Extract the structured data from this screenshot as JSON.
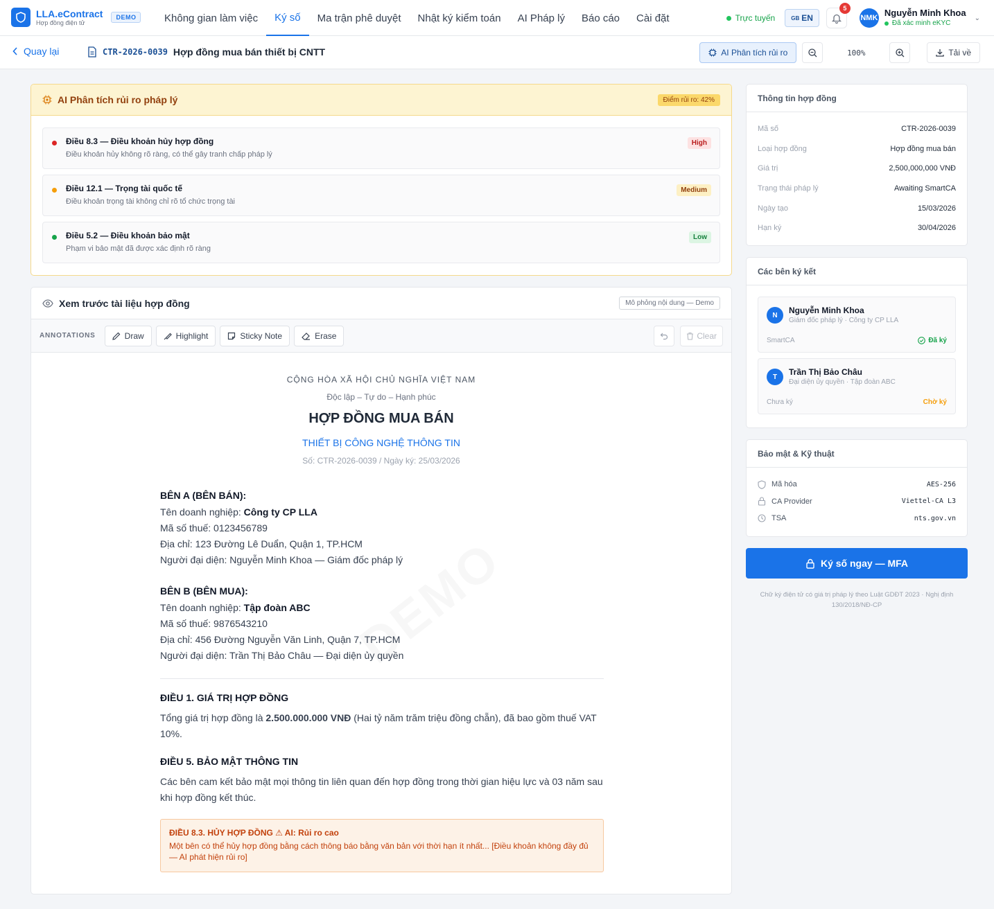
{
  "brand": {
    "name": "LLA.eContract",
    "subtitle": "Hợp đồng điện tử",
    "badge": "DEMO"
  },
  "nav": {
    "tabs": [
      "Không gian làm việc",
      "Ký số",
      "Ma trận phê duyệt",
      "Nhật ký kiểm toán",
      "AI Pháp lý",
      "Báo cáo",
      "Cài đặt"
    ],
    "active_tab": "Ký số"
  },
  "status": {
    "online": "Trực tuyến",
    "lang_flag": "GB",
    "lang": "EN",
    "notifications": "5"
  },
  "user": {
    "initials": "NMK",
    "name": "Nguyễn Minh Khoa",
    "verification": "Đã xác minh eKYC"
  },
  "subbar": {
    "back_label": "Quay lại",
    "doc_code": "CTR-2026-0039",
    "doc_title": "Hợp đồng mua bán thiết bị CNTT",
    "ai_button": "AI Phân tích rủi ro",
    "zoom": "100%",
    "download": "Tải về"
  },
  "risk": {
    "title": "AI Phân tích rủi ro pháp lý",
    "score": "Điểm rủi ro: 42%",
    "items": [
      {
        "title": "Điều 8.3 — Điều khoản hủy hợp đồng",
        "desc": "Điều khoản hủy không rõ ràng, có thể gây tranh chấp pháp lý",
        "severity": "High",
        "color": "#dc2626"
      },
      {
        "title": "Điều 12.1 — Trọng tài quốc tế",
        "desc": "Điều khoản trọng tài không chỉ rõ tổ chức trọng tài",
        "severity": "Medium",
        "color": "#f59e0b"
      },
      {
        "title": "Điều 5.2 — Điều khoản bảo mật",
        "desc": "Phạm vi bảo mật đã được xác định rõ ràng",
        "severity": "Low",
        "color": "#16a34a"
      }
    ]
  },
  "preview": {
    "title": "Xem trước tài liệu hợp đồng",
    "badge": "Mô phỏng nội dung — Demo",
    "annotations_label": "ANNOTATIONS",
    "tools": {
      "draw": "Draw",
      "highlight": "Highlight",
      "sticky": "Sticky Note",
      "erase": "Erase",
      "clear": "Clear"
    },
    "watermark": "DEMO"
  },
  "contract": {
    "republic": "CỘNG HÒA XÃ HỘI CHỦ NGHĨA VIỆT NAM",
    "motto": "Độc lập – Tự do – Hạnh phúc",
    "title": "HỢP ĐỒNG MUA BÁN",
    "subtitle": "THIẾT BỊ CÔNG NGHỆ THÔNG TIN",
    "number": "Số: CTR-2026-0039 / Ngày ký: 25/03/2026",
    "party_a": {
      "heading": "BÊN A (BÊN BÁN):",
      "company_label": "Tên doanh nghiệp: ",
      "company": "Công ty CP LLA",
      "tax": "Mã số thuế: 0123456789",
      "address": "Địa chỉ: 123 Đường Lê Duẩn, Quận 1, TP.HCM",
      "rep": "Người đại diện: Nguyễn Minh Khoa — Giám đốc pháp lý"
    },
    "party_b": {
      "heading": "BÊN B (BÊN MUA):",
      "company_label": "Tên doanh nghiệp: ",
      "company": "Tập đoàn ABC",
      "tax": "Mã số thuế: 9876543210",
      "address": "Địa chỉ: 456 Đường Nguyễn Văn Linh, Quận 7, TP.HCM",
      "rep": "Người đại diện: Trần Thị Bảo Châu — Đại diện ủy quyền"
    },
    "article1": {
      "heading": "ĐIỀU 1. GIÁ TRỊ HỢP ĐỒNG",
      "pre": "Tổng giá trị hợp đồng là ",
      "amount": "2.500.000.000 VNĐ",
      "post": " (Hai tỷ năm trăm triệu đồng chẵn), đã bao gồm thuế VAT 10%."
    },
    "article5": {
      "heading": "ĐIỀU 5. BẢO MẬT THÔNG TIN",
      "text": "Các bên cam kết bảo mật mọi thông tin liên quan đến hợp đồng trong thời gian hiệu lực và 03 năm sau khi hợp đồng kết thúc."
    },
    "warning": {
      "title": "ĐIỀU 8.3. HỦY HỢP ĐỒNG ⚠ AI: Rủi ro cao",
      "text": "Một bên có thể hủy hợp đồng bằng cách thông báo bằng văn bản với thời hạn ít nhất... [Điều khoản không đầy đủ — AI phát hiện rủi ro]"
    }
  },
  "info_card": {
    "title": "Thông tin hợp đồng",
    "rows": [
      {
        "key": "Mã số",
        "value": "CTR-2026-0039"
      },
      {
        "key": "Loại hợp đồng",
        "value": "Hợp đồng mua bán"
      },
      {
        "key": "Giá trị",
        "value": "2,500,000,000 VNĐ"
      },
      {
        "key": "Trạng thái pháp lý",
        "value": "Awaiting SmartCA"
      },
      {
        "key": "Ngày tạo",
        "value": "15/03/2026"
      },
      {
        "key": "Hạn ký",
        "value": "30/04/2026"
      }
    ]
  },
  "parties_card": {
    "title": "Các bên ký kết",
    "parties": [
      {
        "initial": "N",
        "name": "Nguyễn Minh Khoa",
        "role": "Giám đốc pháp lý · Công ty CP LLA",
        "ca": "SmartCA",
        "status": "Đã ký",
        "status_color": "#16a34a"
      },
      {
        "initial": "T",
        "name": "Trần Thị Bảo Châu",
        "role": "Đại diện ủy quyền · Tập đoàn ABC",
        "ca": "Chưa ký",
        "status": "Chờ ký",
        "status_color": "#f59e0b"
      }
    ]
  },
  "security_card": {
    "title": "Bảo mật & Kỹ thuật",
    "rows": [
      {
        "key": "Mã hóa",
        "value": "AES-256"
      },
      {
        "key": "CA Provider",
        "value": "Viettel-CA L3"
      },
      {
        "key": "TSA",
        "value": "nts.gov.vn"
      }
    ]
  },
  "sign_button": "Ký số ngay — MFA",
  "legal_note": "Chữ ký điện tử có giá trị pháp lý theo Luật GDĐT 2023 · Nghị định 130/2018/NĐ-CP"
}
